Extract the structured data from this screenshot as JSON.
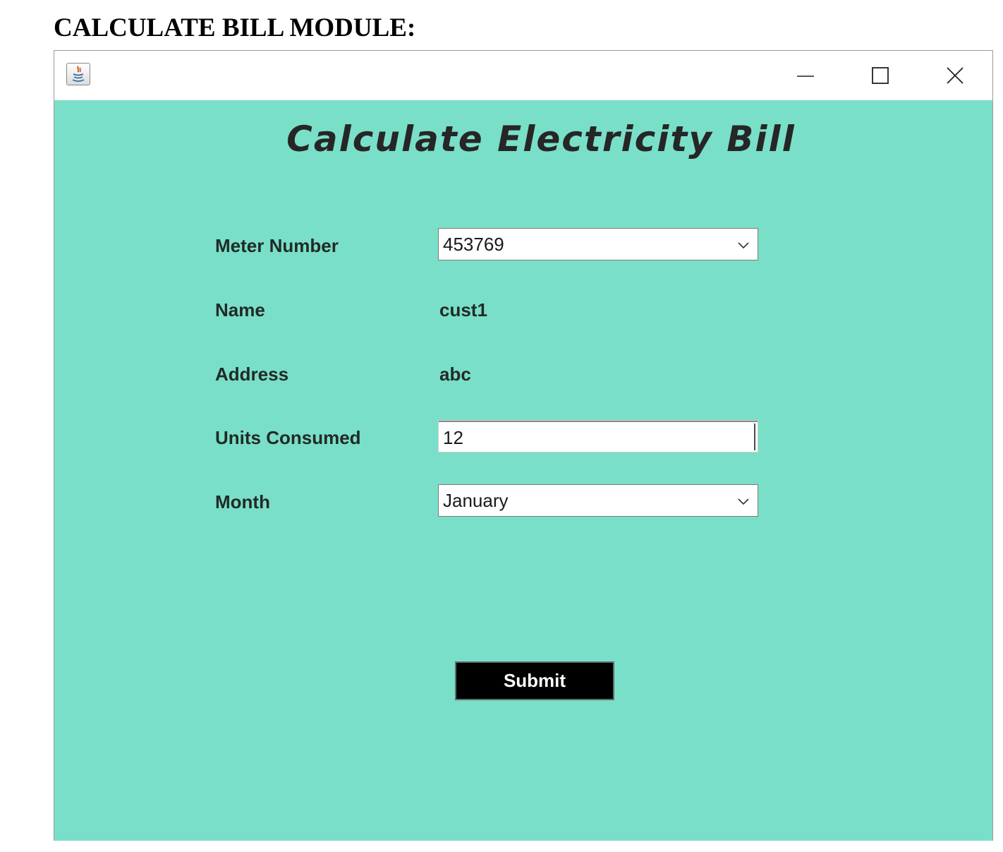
{
  "document": {
    "heading": "CALCULATE BILL MODULE:"
  },
  "window": {
    "app_icon": "java-icon",
    "controls": {
      "minimize_icon": "minimize-icon",
      "maximize_icon": "maximize-icon",
      "close_icon": "close-icon"
    }
  },
  "form": {
    "title": "Calculate Electricity Bill",
    "meter_number": {
      "label": "Meter Number",
      "selected": "453769"
    },
    "name": {
      "label": "Name",
      "value": "cust1"
    },
    "address": {
      "label": "Address",
      "value": "abc"
    },
    "units_consumed": {
      "label": "Units Consumed",
      "value": "12"
    },
    "month": {
      "label": "Month",
      "selected": "January"
    },
    "submit_label": "Submit"
  },
  "colors": {
    "background": "#7adfc8",
    "button": "#000000",
    "button_text": "#ffffff"
  }
}
